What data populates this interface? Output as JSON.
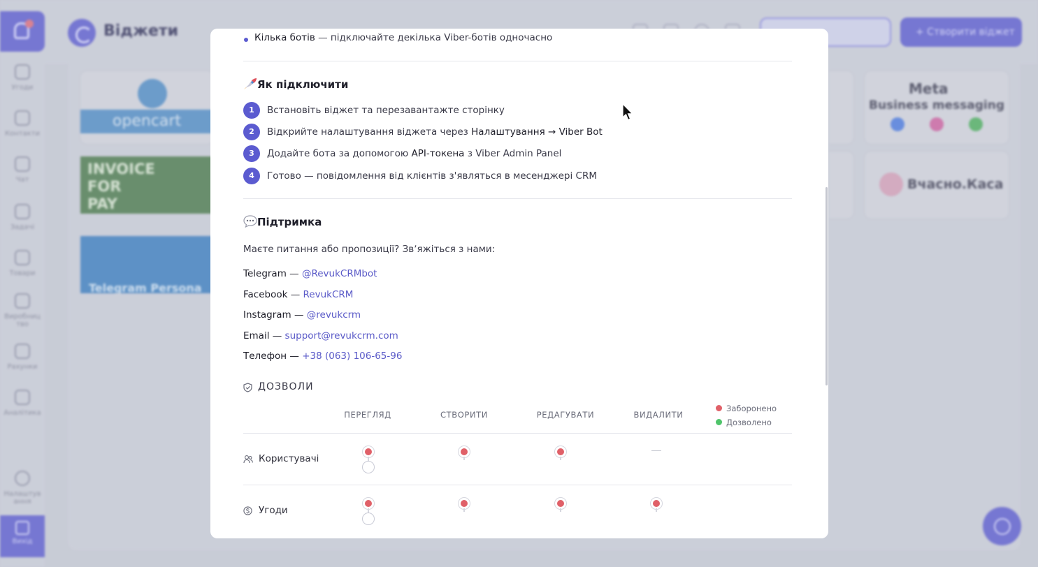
{
  "app": {
    "title": "Віджети",
    "header_buttons": {
      "install_code": "",
      "create_widget": "+ Створити віджет"
    },
    "sidebar": {
      "items": [
        {
          "label": "Угоди",
          "icon": "deals-icon"
        },
        {
          "label": "Контакти",
          "icon": "contacts-icon"
        },
        {
          "label": "Чат",
          "icon": "chat-icon"
        },
        {
          "label": "Задачі",
          "icon": "tasks-icon"
        },
        {
          "label": "Товари",
          "icon": "products-icon"
        },
        {
          "label": "Виробництво",
          "icon": "production-icon"
        },
        {
          "label": "Рахунки",
          "icon": "invoices-icon"
        },
        {
          "label": "Аналітика",
          "icon": "analytics-icon"
        },
        {
          "label": "Налаштування",
          "icon": "settings-icon"
        }
      ],
      "exit": "Вихід"
    },
    "widget_tiles": {
      "opencart": "opencart",
      "invoice": "INVOICE FOR PAY",
      "telegram": "Telegram Persona",
      "meta_title": "Meta",
      "meta_subtitle": "Business messaging",
      "kasa": "Вчасно.Каса"
    }
  },
  "modal": {
    "features_bullet": {
      "bold": "Кілька ботів",
      "rest": " — підключайте декілька Viber-ботів одночасно"
    },
    "how_to": {
      "title": "Як підключити",
      "steps": [
        {
          "n": "1",
          "parts": [
            "Встановіть віджет та перезавантажте сторінку"
          ]
        },
        {
          "n": "2",
          "parts": [
            "Відкрийте налаштування віджета через ",
            "Налаштування → Viber Bot"
          ]
        },
        {
          "n": "3",
          "parts": [
            "Додайте бота за допомогою ",
            "API-токена",
            " з Viber Admin Panel"
          ]
        },
        {
          "n": "4",
          "parts": [
            "Готово — повідомлення від клієнтів з'являться в месенджері CRM"
          ]
        }
      ]
    },
    "support": {
      "title": "Підтримка",
      "intro": "Маєте питання або пропозиції? Звʼяжіться з нами:",
      "contacts": [
        {
          "label": "Telegram — ",
          "value": "@RevukCRMbot"
        },
        {
          "label": "Facebook — ",
          "value": "RevukCRM"
        },
        {
          "label": "Instagram — ",
          "value": "@revukcrm"
        },
        {
          "label": "Email — ",
          "value": "support@revukcrm.com"
        },
        {
          "label": "Телефон — ",
          "value": "+38 (063) 106-65-96"
        }
      ]
    },
    "permissions": {
      "title": "ДОЗВОЛИ",
      "columns": [
        "ПЕРЕГЛЯД",
        "СТВОРИТИ",
        "РЕДАГУВАТИ",
        "ВИДАЛИТИ"
      ],
      "legend": {
        "denied": "Заборонено",
        "allowed": "Дозволено"
      },
      "rows": [
        {
          "label": "Користувачі",
          "view": "Заборонено",
          "create": "Заборонено",
          "edit": "Заборонено",
          "delete": "—"
        },
        {
          "label": "Угоди",
          "view": "Заборонено",
          "create": "Заборонено",
          "edit": "Заборонено",
          "delete": "Заборонено"
        }
      ]
    }
  },
  "colors": {
    "accent": "#5b5bd0",
    "denied": "#e06068",
    "allowed": "#4fc46a",
    "link": "#5a5ac8"
  }
}
